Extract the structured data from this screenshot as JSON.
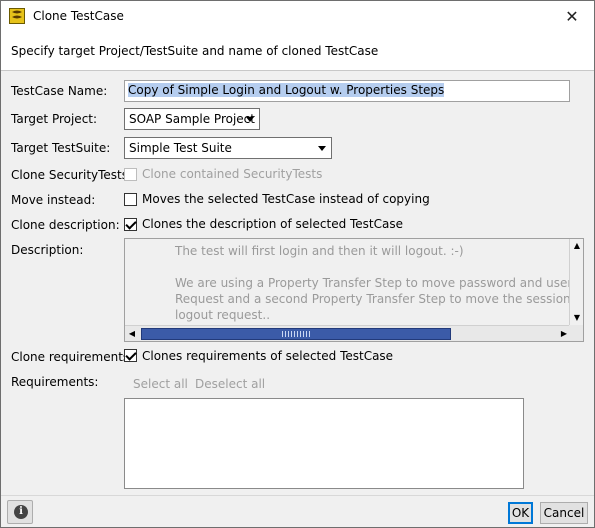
{
  "window": {
    "title": "Clone TestCase",
    "close_glyph": "✕",
    "icon": "soapui-app-icon"
  },
  "header": {
    "text": "Specify target Project/TestSuite and name of cloned TestCase"
  },
  "form": {
    "testcase_name": {
      "label": "TestCase Name:",
      "value": "Copy of Simple Login and Logout w. Properties Steps"
    },
    "target_project": {
      "label": "Target Project:",
      "value": "SOAP Sample Project"
    },
    "target_testsuite": {
      "label": "Target TestSuite:",
      "value": "Simple Test Suite"
    },
    "clone_security": {
      "label": "Clone SecurityTests:",
      "checkbox_label": "Clone contained SecurityTests",
      "checked": false,
      "enabled": false
    },
    "move_instead": {
      "label": "Move instead:",
      "checkbox_label": "Moves the selected TestCase instead of copying",
      "checked": false
    },
    "clone_description": {
      "label": "Clone description:",
      "checkbox_label": "Clones the description of selected TestCase",
      "checked": true
    },
    "description": {
      "label": "Description:",
      "text": "The test will first login and then it will logout. :-)\n\nWe are using a Property Transfer Step to move password and user name fro\nRequest and a second Property Transfer Step to move the sessionID we got\nlogout request.."
    },
    "clone_requirements": {
      "label": "Clone requirements:",
      "checkbox_label": "Clones requirements of selected TestCase",
      "checked": true
    },
    "requirements": {
      "label": "Requirements:",
      "select_all": "Select all",
      "deselect_all": "Deselect all"
    }
  },
  "footer": {
    "ok_label": "OK",
    "cancel_label": "Cancel",
    "info_glyph": "i"
  }
}
